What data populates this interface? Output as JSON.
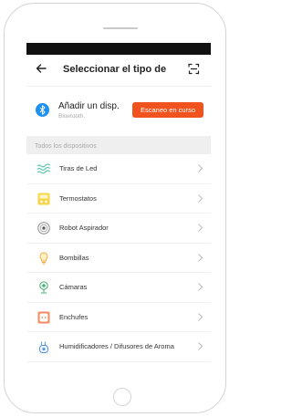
{
  "header": {
    "title": "Seleccionar el tipo de"
  },
  "bluetooth": {
    "title": "Añadir un disp.",
    "subtitle": "Bluetooth.",
    "button": "Escaneo en curso"
  },
  "section": {
    "label": "Todos los dispositivos"
  },
  "devices": [
    {
      "label": "Tiras de Led",
      "icon": "led-strip-icon"
    },
    {
      "label": "Termostatos",
      "icon": "thermostat-icon"
    },
    {
      "label": "Robot Aspirador",
      "icon": "robot-vacuum-icon"
    },
    {
      "label": "Bombillas",
      "icon": "light-bulb-icon"
    },
    {
      "label": "Cámaras",
      "icon": "camera-icon"
    },
    {
      "label": "Enchufes",
      "icon": "plug-icon"
    },
    {
      "label": "Humidificadores / Difusores de Aroma",
      "icon": "humidifier-icon"
    }
  ],
  "colors": {
    "accent": "#f0531e",
    "bluetooth": "#1e90f0",
    "statusbar": "#111111",
    "section_bg": "#efefef"
  }
}
